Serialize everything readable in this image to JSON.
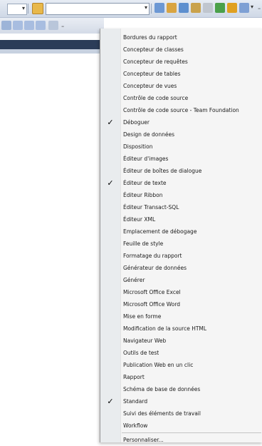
{
  "toolbar": {
    "search_combo_value": "",
    "combo_placeholder": ""
  },
  "menu": {
    "items": [
      {
        "label": "Bordures du rapport",
        "checked": false
      },
      {
        "label": "Concepteur de classes",
        "checked": false
      },
      {
        "label": "Concepteur de requêtes",
        "checked": false
      },
      {
        "label": "Concepteur de tables",
        "checked": false
      },
      {
        "label": "Concepteur de vues",
        "checked": false
      },
      {
        "label": "Contrôle de code source",
        "checked": false
      },
      {
        "label": "Contrôle de code source - Team Foundation",
        "checked": false
      },
      {
        "label": "Déboguer",
        "checked": true
      },
      {
        "label": "Design de données",
        "checked": false
      },
      {
        "label": "Disposition",
        "checked": false
      },
      {
        "label": "Éditeur d'images",
        "checked": false
      },
      {
        "label": "Éditeur de boîtes de dialogue",
        "checked": false
      },
      {
        "label": "Éditeur de texte",
        "checked": true
      },
      {
        "label": "Éditeur Ribbon",
        "checked": false
      },
      {
        "label": "Éditeur Transact-SQL",
        "checked": false
      },
      {
        "label": "Éditeur XML",
        "checked": false
      },
      {
        "label": "Emplacement de débogage",
        "checked": false
      },
      {
        "label": "Feuille de style",
        "checked": false
      },
      {
        "label": "Formatage du rapport",
        "checked": false
      },
      {
        "label": "Générateur de données",
        "checked": false
      },
      {
        "label": "Générer",
        "checked": false
      },
      {
        "label": "Microsoft Office Excel",
        "checked": false
      },
      {
        "label": "Microsoft Office Word",
        "checked": false
      },
      {
        "label": "Mise en forme",
        "checked": false
      },
      {
        "label": "Modification de la source HTML",
        "checked": false
      },
      {
        "label": "Navigateur Web",
        "checked": false
      },
      {
        "label": "Outils de test",
        "checked": false
      },
      {
        "label": "Publication Web en un clic",
        "checked": false
      },
      {
        "label": "Rapport",
        "checked": false
      },
      {
        "label": "Schéma de base de données",
        "checked": false
      },
      {
        "label": "Standard",
        "checked": true
      },
      {
        "label": "Suivi des éléments de travail",
        "checked": false
      },
      {
        "label": "Workflow",
        "checked": false
      }
    ],
    "customize_label": "Personnaliser...",
    "check_glyph": "✓"
  },
  "colors": {
    "check_color": "#000000",
    "band_color": "#2b3c58"
  },
  "icons": [
    "folder-open-icon",
    "find-icon",
    "properties-icon",
    "toolbox-icon",
    "solution-explorer-icon",
    "tools-icon",
    "start-page-icon",
    "object-browser-icon",
    "command-window-icon"
  ]
}
